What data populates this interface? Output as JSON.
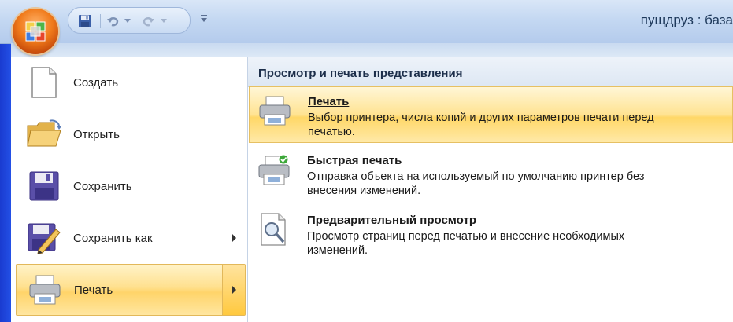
{
  "window": {
    "title": "пущдруз : база"
  },
  "quick_access": {
    "items": [
      {
        "name": "save-icon"
      },
      {
        "name": "undo-icon"
      },
      {
        "name": "redo-icon"
      }
    ],
    "customize_icon": "customize-quick-access-icon"
  },
  "office_button": {
    "icon": "office-logo-icon"
  },
  "menu": {
    "left": [
      {
        "label": "Создать",
        "icon": "new-document-icon",
        "submenu": false
      },
      {
        "label": "Открыть",
        "icon": "open-folder-icon",
        "submenu": false
      },
      {
        "label": "Сохранить",
        "icon": "floppy-save-icon",
        "submenu": false
      },
      {
        "label": "Сохранить как",
        "icon": "save-as-icon",
        "submenu": true
      },
      {
        "label": "Печать",
        "icon": "printer-icon",
        "submenu": true,
        "active": true
      }
    ],
    "right": {
      "header": "Просмотр и печать представления",
      "options": [
        {
          "title": "Печать",
          "description": "Выбор принтера, числа копий и других параметров печати перед печатью.",
          "icon": "printer-icon",
          "active": true
        },
        {
          "title": "Быстрая печать",
          "description": "Отправка объекта на используемый по умолчанию принтер без внесения изменений.",
          "icon": "quick-print-icon",
          "active": false
        },
        {
          "title": "Предварительный просмотр",
          "description": "Просмотр страниц перед печатью и внесение необходимых изменений.",
          "icon": "print-preview-icon",
          "active": false
        }
      ]
    }
  },
  "colors": {
    "frame": "#1f43d6",
    "highlight": "#ffd46a",
    "title_text": "#1e395b"
  }
}
